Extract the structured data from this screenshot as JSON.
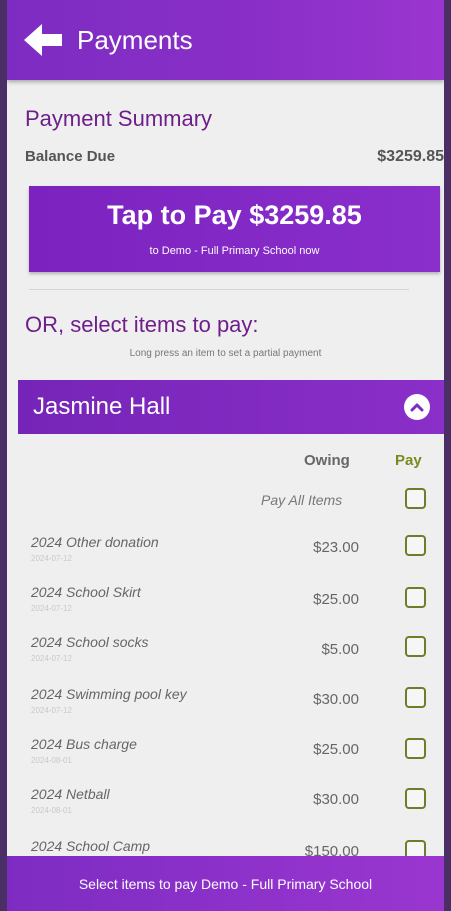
{
  "header": {
    "title": "Payments"
  },
  "summary": {
    "title": "Payment Summary",
    "balance_label": "Balance Due",
    "balance_value": "$3259.85",
    "pay_button_main": "Tap to Pay $3259.85",
    "pay_button_sub": "to Demo - Full Primary School now"
  },
  "select": {
    "title": "OR, select items to pay:",
    "hint": "Long press an item to set a partial payment"
  },
  "student": {
    "name": "Jasmine Hall"
  },
  "columns": {
    "owing": "Owing",
    "pay": "Pay",
    "pay_all": "Pay All Items"
  },
  "items": [
    {
      "name": "2024 Other donation",
      "date": "2024-07-12",
      "amount": "$23.00"
    },
    {
      "name": "2024 School Skirt",
      "date": "2024-07-12",
      "amount": "$25.00"
    },
    {
      "name": "2024 School socks",
      "date": "2024-07-12",
      "amount": "$5.00"
    },
    {
      "name": "2024 Swimming pool key",
      "date": "2024-07-12",
      "amount": "$30.00"
    },
    {
      "name": "2024 Bus charge",
      "date": "2024-08-01",
      "amount": "$25.00"
    },
    {
      "name": "2024 Netball",
      "date": "2024-08-01",
      "amount": "$30.00"
    },
    {
      "name": "2024 School Camp",
      "date": "",
      "amount": "$150.00"
    }
  ],
  "footer": {
    "label": "Select items to pay Demo - Full Primary School"
  },
  "colors": {
    "header": "#8a2fc8",
    "accent_text": "#6e1f8a",
    "checkbox": "#6f7d2a"
  }
}
